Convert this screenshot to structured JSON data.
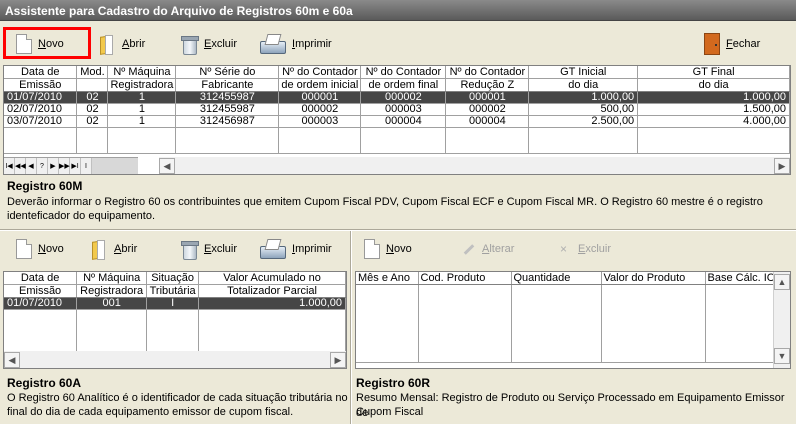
{
  "window": {
    "title": "Assistente para Cadastro do Arquivo de Registros 60m e 60a"
  },
  "toolbar_top": {
    "novo": "Novo",
    "abrir": "Abrir",
    "excluir": "Excluir",
    "imprimir": "Imprimir",
    "fechar": "Fechar"
  },
  "grid60m": {
    "headers": [
      [
        "Data de",
        "Emissão"
      ],
      [
        "Mod.",
        ""
      ],
      [
        "Nº Máquina",
        "Registradora"
      ],
      [
        "Nº Série do",
        "Fabricante"
      ],
      [
        "Nº do Contador",
        "de ordem inicial"
      ],
      [
        "Nº do Contador",
        "de ordem final"
      ],
      [
        "Nº do Contador",
        "Redução Z"
      ],
      [
        "GT Inicial",
        "do dia"
      ],
      [
        "GT Final",
        "do dia"
      ]
    ],
    "rows": [
      [
        "01/07/2010",
        "02",
        "1",
        "312455987",
        "000001",
        "000002",
        "000001",
        "1.000,00",
        "1.000,00"
      ],
      [
        "02/07/2010",
        "02",
        "1",
        "312455987",
        "000002",
        "000003",
        "000002",
        "500,00",
        "1.500,00"
      ],
      [
        "03/07/2010",
        "02",
        "1",
        "312456987",
        "000003",
        "000004",
        "000004",
        "2.500,00",
        "4.000,00"
      ]
    ]
  },
  "section60m": {
    "title": "Registro 60M",
    "desc1": "Deverão informar o Registro 60 os contribuintes que emitem Cupom Fiscal PDV, Cupom Fiscal ECF e Cupom Fiscal MR. O Registro 60 mestre é o registro",
    "desc2": "identeficador do equipamento."
  },
  "toolbar_60a": {
    "novo": "Novo",
    "abrir": "Abrir",
    "excluir": "Excluir",
    "imprimir": "Imprimir"
  },
  "toolbar_60r": {
    "novo": "Novo",
    "alterar": "Alterar",
    "excluir": "Excluir"
  },
  "grid60a": {
    "headers": [
      [
        "Data de",
        "Emissão"
      ],
      [
        "Nº Máquina",
        "Registradora"
      ],
      [
        "Situação",
        "Tributária"
      ],
      [
        "Valor Acumulado no",
        "Totalizador Parcial"
      ]
    ],
    "rows": [
      [
        "01/07/2010",
        "001",
        "I",
        "1.000,00"
      ]
    ]
  },
  "grid60r": {
    "headers": [
      "Mês e Ano",
      "Cod. Produto",
      "Quantidade",
      "Valor do Produto",
      "Base Cálc. IC"
    ]
  },
  "section60a": {
    "title": "Registro 60A",
    "desc1": "O Registro 60 Analítico é o identificador de cada situação tributária no",
    "desc2": "final do dia de cada equipamento emissor de cupom fiscal."
  },
  "section60r": {
    "title": "Registro 60R",
    "desc1": "Resumo Mensal: Registro de Produto ou Serviço Processado em Equipamento Emissor de",
    "desc2": "Cupom Fiscal"
  },
  "nav": [
    "I◀",
    "◀◀",
    "◀",
    "?",
    "▶",
    "▶▶",
    "▶I",
    "I"
  ]
}
